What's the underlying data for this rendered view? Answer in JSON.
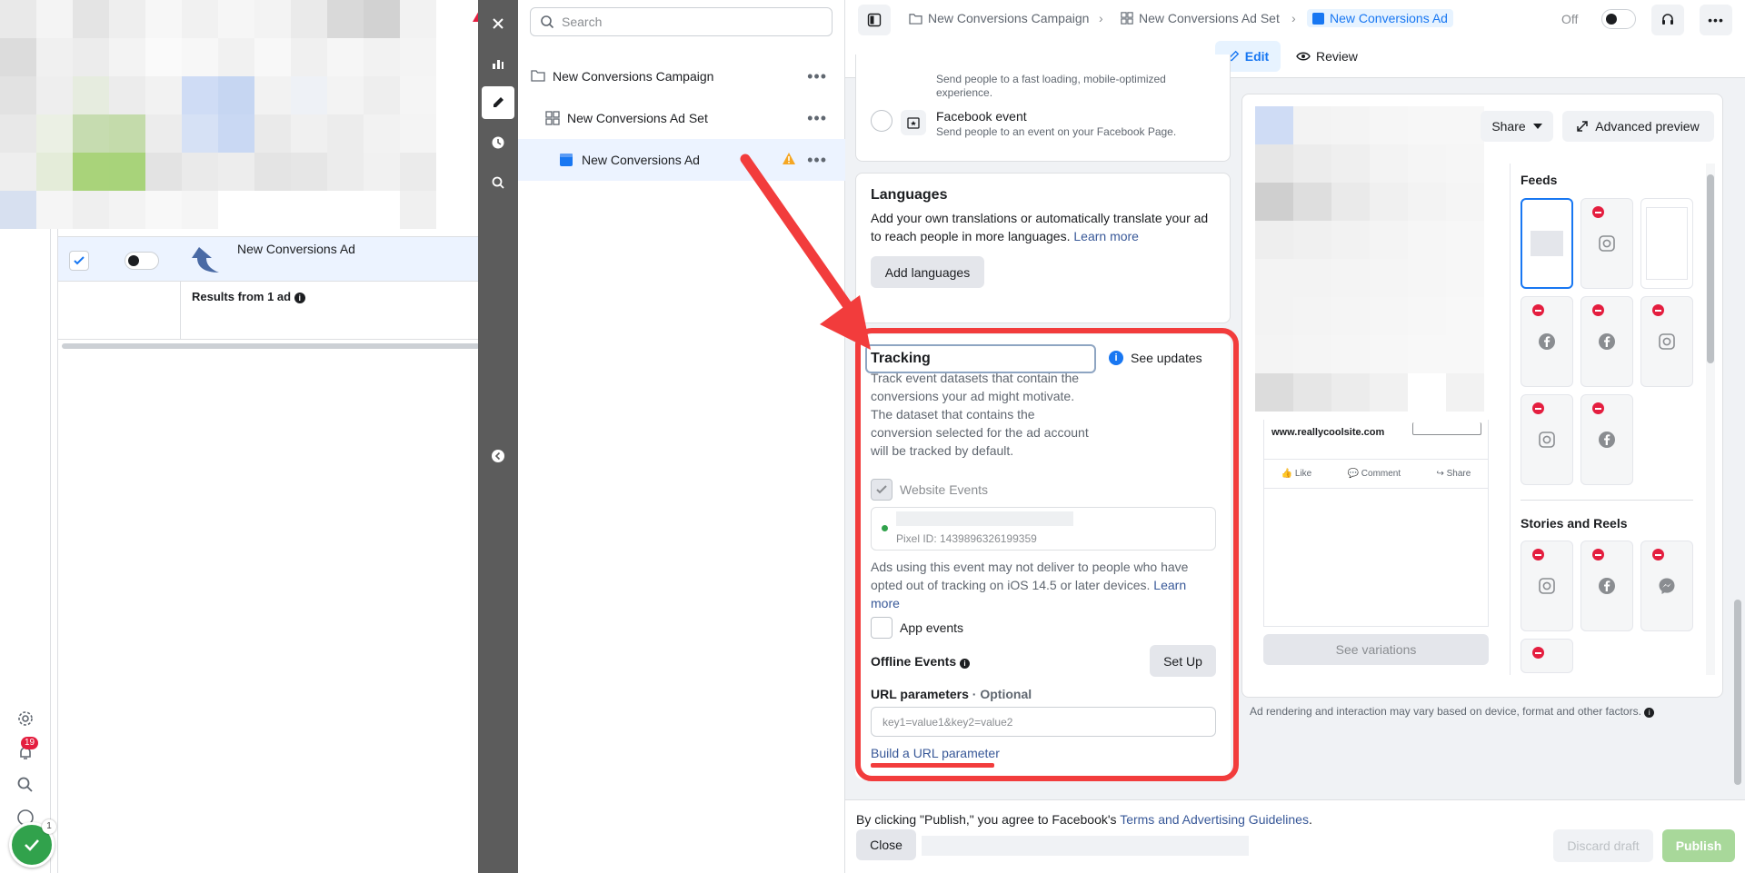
{
  "left": {
    "row_name": "New Conversions Ad",
    "results_text": "Results from 1 ad",
    "notifications_count": "19",
    "check_count": "1"
  },
  "tree": {
    "search_placeholder": "Search",
    "campaign": "New Conversions Campaign",
    "adset": "New Conversions Ad Set",
    "ad": "New Conversions Ad"
  },
  "breadcrumb": {
    "campaign": "New Conversions Campaign",
    "adset": "New Conversions Ad Set",
    "ad": "New Conversions Ad"
  },
  "header": {
    "edit": "Edit",
    "review": "Review",
    "status": "Off"
  },
  "destination": {
    "partial_line1": "Send people to a fast loading, mobile-optimized",
    "partial_line2": "experience.",
    "event_title": "Facebook event",
    "event_desc": "Send people to an event on your Facebook Page."
  },
  "languages": {
    "title": "Languages",
    "desc": "Add your own translations or automatically translate your ad to reach people in more languages.",
    "learn_more": "Learn more",
    "button": "Add languages"
  },
  "tracking": {
    "title": "Tracking",
    "see_updates": "See updates",
    "desc1": "Track event datasets that contain the conversions your ad might motivate.",
    "desc2": "The dataset that contains the conversion selected for the ad account will be tracked by default.",
    "website_events": "Website Events",
    "pixel_id": "Pixel ID: 1439896326199359",
    "ios_note": "Ads using this event may not deliver to people who have opted out of tracking on iOS 14.5 or later devices.",
    "learn": "Learn",
    "more": "more",
    "app_events": "App events",
    "offline_events": "Offline Events",
    "set_up": "Set Up",
    "url_params": "URL parameters",
    "optional": "· Optional",
    "url_placeholder": "key1=value1&key2=value2",
    "build_link": "Build a URL parameter"
  },
  "preview": {
    "share": "Share",
    "advanced_preview": "Advanced preview",
    "feeds": "Feeds",
    "stories_reels": "Stories and Reels",
    "site": "www.reallycoolsite.com",
    "like": "Like",
    "comment": "Comment",
    "share_action": "Share",
    "see_variations": "See variations",
    "render_note": "Ad rendering and interaction may vary based on device, format and other factors."
  },
  "footer": {
    "terms_prefix": "By clicking \"Publish,\" you agree to Facebook's",
    "terms_link": "Terms and Advertising Guidelines",
    "terms_suffix": ".",
    "close": "Close",
    "discard": "Discard draft",
    "publish": "Publish"
  },
  "colors": {
    "accent": "#1877f2",
    "highlight_red": "#f23c3c",
    "publish_disabled": "#a8d89a"
  }
}
